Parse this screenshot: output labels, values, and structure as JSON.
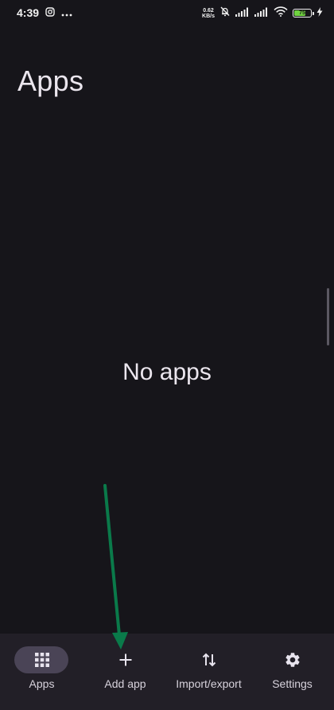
{
  "status_bar": {
    "time": "4:39",
    "net_speed_value": "0.62",
    "net_speed_unit": "KB/s",
    "battery_level": "75",
    "icons": [
      "instagram-icon",
      "more-dots-icon",
      "mute-bell-icon",
      "signal-icon",
      "signal-icon",
      "wifi-icon",
      "battery-icon",
      "charging-icon"
    ]
  },
  "header": {
    "title": "Apps"
  },
  "main": {
    "empty_message": "No apps"
  },
  "bottom_nav": {
    "items": [
      {
        "label": "Apps",
        "icon": "grid-icon",
        "active": true
      },
      {
        "label": "Add app",
        "icon": "plus-icon",
        "active": false
      },
      {
        "label": "Import/export",
        "icon": "swap-vertical-icon",
        "active": false
      },
      {
        "label": "Settings",
        "icon": "gear-icon",
        "active": false
      }
    ]
  },
  "colors": {
    "background": "#16151a",
    "nav_background": "#221f27",
    "active_pill": "#4a4456",
    "annotation_arrow": "#0a7a4a",
    "battery_fill": "#6fd240"
  }
}
